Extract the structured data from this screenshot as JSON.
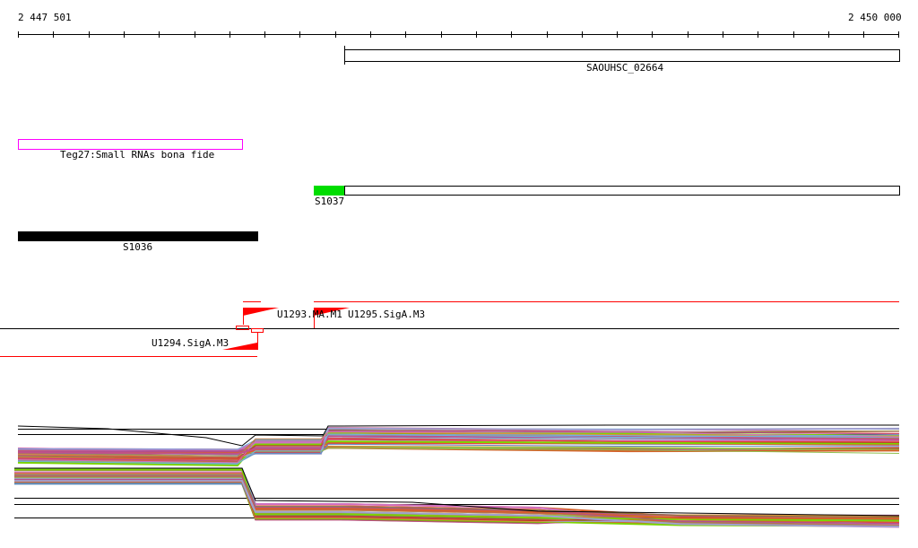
{
  "ruler": {
    "start_label": "2 447 501",
    "end_label": "2 450 000"
  },
  "features": {
    "gene": {
      "label": "SAOUHSC_02664"
    },
    "srna": {
      "label": "Teg27:Small RNAs bona fide",
      "color": "#ff00ff"
    },
    "s1037": {
      "label": "S1037",
      "color": "#00dd00"
    },
    "s1036": {
      "label": "S1036"
    }
  },
  "promoters": {
    "u1293": {
      "label": "U1293.MA.M1"
    },
    "u1295": {
      "label": "U1295.SigA.M3"
    },
    "u1294": {
      "label": "U1294.SigA.M3"
    },
    "color": "#ff0000"
  },
  "expression": {
    "palette": [
      "#e8463a",
      "#c0508a",
      "#6fb3e0",
      "#8a7a2a",
      "#7cd400",
      "#d4622a",
      "#b05090",
      "#a0a0d0",
      "#e09040",
      "#5a8ac0",
      "#c03030",
      "#90c050",
      "#b07850",
      "#d070c0"
    ]
  }
}
